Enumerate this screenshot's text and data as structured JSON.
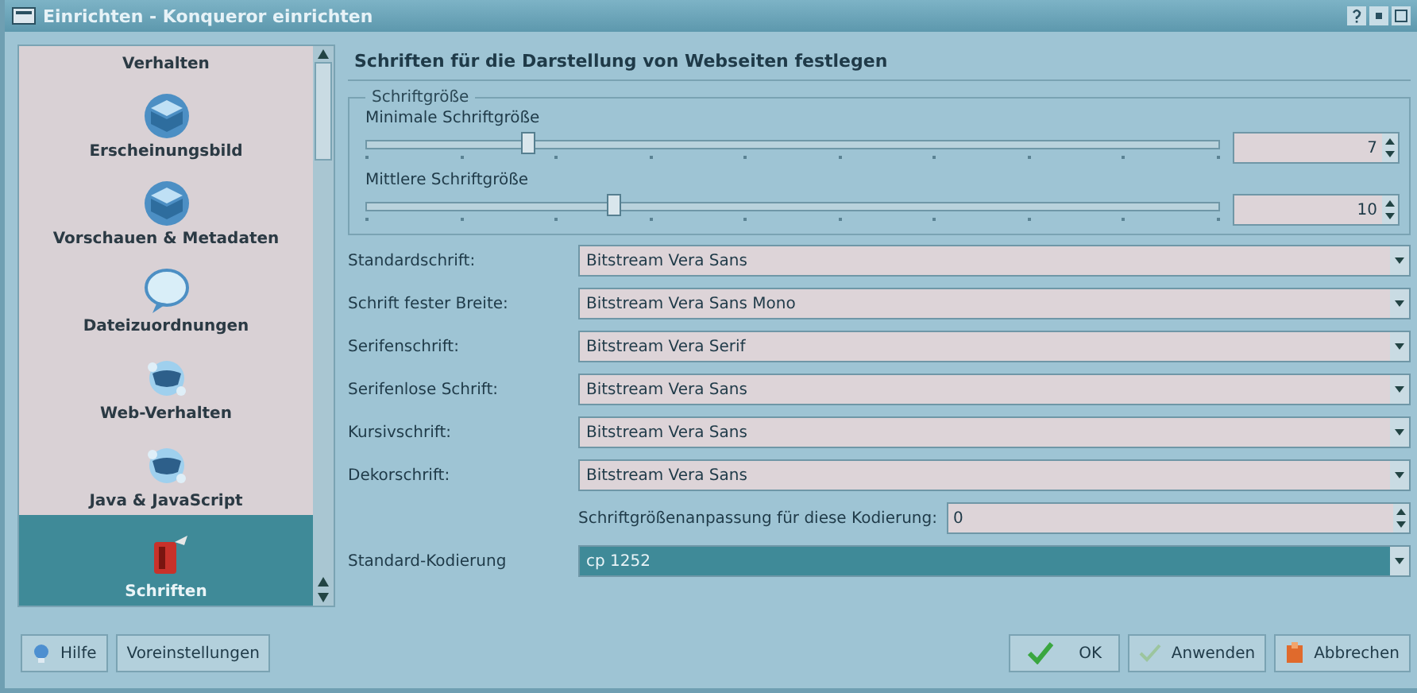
{
  "window": {
    "title": "Einrichten - Konqueror einrichten"
  },
  "sidebar": {
    "items": [
      {
        "label": "Verhalten",
        "kind": "none",
        "selected": false
      },
      {
        "label": "Erscheinungsbild",
        "kind": "cube",
        "selected": false
      },
      {
        "label": "Vorschauen & Metadaten",
        "kind": "cube",
        "selected": false
      },
      {
        "label": "Dateizuordnungen",
        "kind": "bubble",
        "selected": false
      },
      {
        "label": "Web-Verhalten",
        "kind": "globe",
        "selected": false
      },
      {
        "label": "Java & JavaScript",
        "kind": "globe",
        "selected": false
      },
      {
        "label": "Schriften",
        "kind": "font",
        "selected": true
      }
    ]
  },
  "heading": "Schriften für die Darstellung von Webseiten festlegen",
  "size_group": {
    "legend": "Schriftgröße",
    "sliders": [
      {
        "label": "Minimale Schriftgröße",
        "level": 0.19,
        "value": "7"
      },
      {
        "label": "Mittlere Schriftgröße",
        "level": 0.29,
        "value": "10"
      }
    ]
  },
  "fonts": [
    {
      "label": "Standardschrift:",
      "value": "Bitstream Vera Sans"
    },
    {
      "label": "Schrift fester Breite:",
      "value": "Bitstream Vera Sans Mono"
    },
    {
      "label": "Serifenschrift:",
      "value": "Bitstream Vera Serif"
    },
    {
      "label": "Serifenlose Schrift:",
      "value": "Bitstream Vera Sans"
    },
    {
      "label": "Kursivschrift:",
      "value": "Bitstream Vera Sans"
    },
    {
      "label": "Dekorschrift:",
      "value": "Bitstream Vera Sans"
    }
  ],
  "adjust": {
    "label": "Schriftgrößenanpassung für diese Kodierung:",
    "value": "0"
  },
  "encoding": {
    "label": "Standard-Kodierung",
    "value": "cp 1252",
    "selected": true
  },
  "buttons_left": [
    {
      "label": "Hilfe",
      "kind": "help"
    },
    {
      "label": "Voreinstellungen",
      "kind": "plain"
    }
  ],
  "buttons_right": [
    {
      "label": "OK",
      "kind": "check"
    },
    {
      "label": "Anwenden",
      "kind": "check-light"
    },
    {
      "label": "Abbrechen",
      "kind": "cancel"
    }
  ]
}
